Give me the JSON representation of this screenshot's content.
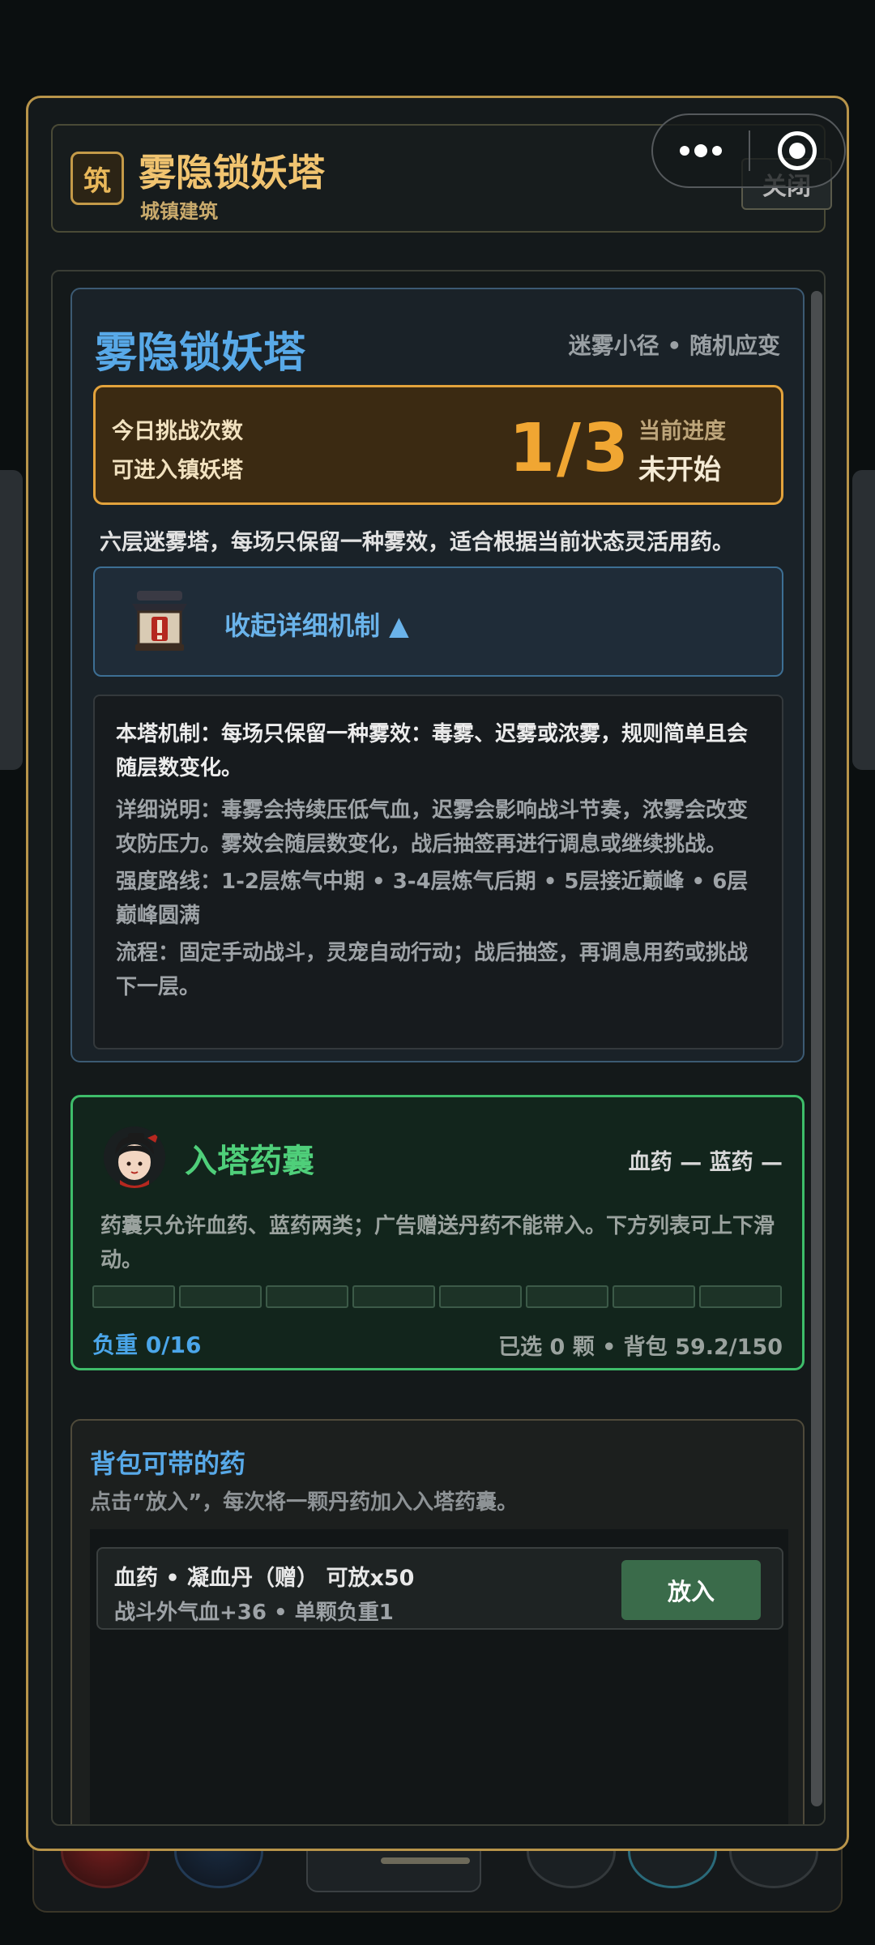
{
  "header": {
    "badge": "筑",
    "title": "雾隐锁妖塔",
    "subtitle": "城镇建筑",
    "close_label": "关闭"
  },
  "tower": {
    "name": "雾隐锁妖塔",
    "tags": "迷雾小径 • 随机应变",
    "challenge_line1": "今日挑战次数",
    "challenge_line2": "可进入镇妖塔",
    "challenge_count": "1/3",
    "progress_label": "当前进度",
    "progress_value": "未开始",
    "description": "六层迷雾塔，每场只保留一种雾效，适合根据当前状态灵活用药。",
    "collapse_label": "收起详细机制 ▲",
    "details": {
      "mechanism": "本塔机制：每场只保留一种雾效：毒雾、迟雾或浓雾，规则简单且会随层数变化。",
      "explanation": "详细说明：毒雾会持续压低气血，迟雾会影响战斗节奏，浓雾会改变攻防压力。雾效会随层数变化，战后抽签再进行调息或继续挑战。",
      "route": "强度路线：1-2层炼气中期 • 3-4层炼气后期 • 5层接近巅峰 • 6层巅峰圆满",
      "flow": "流程：固定手动战斗，灵宠自动行动；战后抽签，再调息用药或挑战下一层。"
    }
  },
  "bag": {
    "title": "入塔药囊",
    "stats": "血药 —  蓝药 —",
    "description": "药囊只允许血药、蓝药两类；广告赠送丹药不能带入。下方列表可上下滑动。",
    "load": "负重 0/16",
    "info": "已选 0 颗 • 背包 59.2/150"
  },
  "pack": {
    "title": "背包可带的药",
    "hint": "点击“放入”，每次将一颗丹药加入入塔药囊。",
    "items": [
      {
        "name": "血药 • 凝血丹（赠） 可放x50",
        "desc": "战斗外气血+36 • 单颗负重1",
        "button": "放入"
      }
    ]
  },
  "colors": {
    "frame_gold": "#b8944a",
    "tower_blue": "#58a9e8",
    "challenge_orange": "#f0a632",
    "bag_green": "#3ebd6a"
  },
  "icons": {
    "collapse": "tower-warning-icon",
    "bag": "character-avatar-icon",
    "capsule_more": "more-dots-icon",
    "capsule_close": "target-close-icon"
  }
}
